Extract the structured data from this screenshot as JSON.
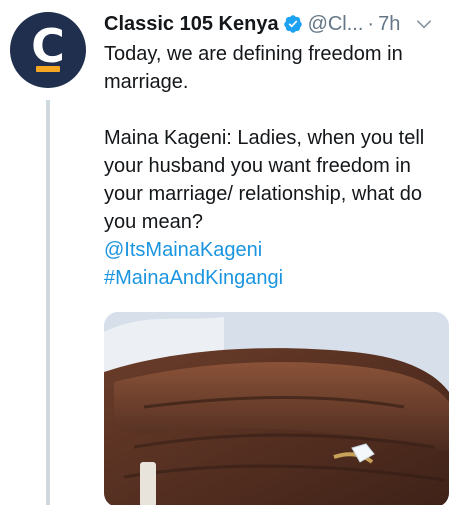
{
  "tweet": {
    "avatar_letter": "C",
    "account_name": "Classic 105 Kenya",
    "handle": "@Cl...",
    "separator": "·",
    "time": "7h",
    "text_line1": "Today, we are defining freedom in marriage.",
    "text_line2": "Maina Kageni: Ladies, when you tell your husband you want freedom in your marriage/ relationship, what do you mean?",
    "mention": "@ItsMainaKageni",
    "hashtag": "#MainaAndKingangi"
  },
  "icons": {
    "verified": "verified-badge-icon",
    "more": "chevron-down-icon"
  },
  "colors": {
    "avatar_bg": "#1f2f4d",
    "avatar_accent": "#f5a623",
    "link": "#1b95e0",
    "verified": "#1da1f2",
    "muted": "#657786"
  }
}
